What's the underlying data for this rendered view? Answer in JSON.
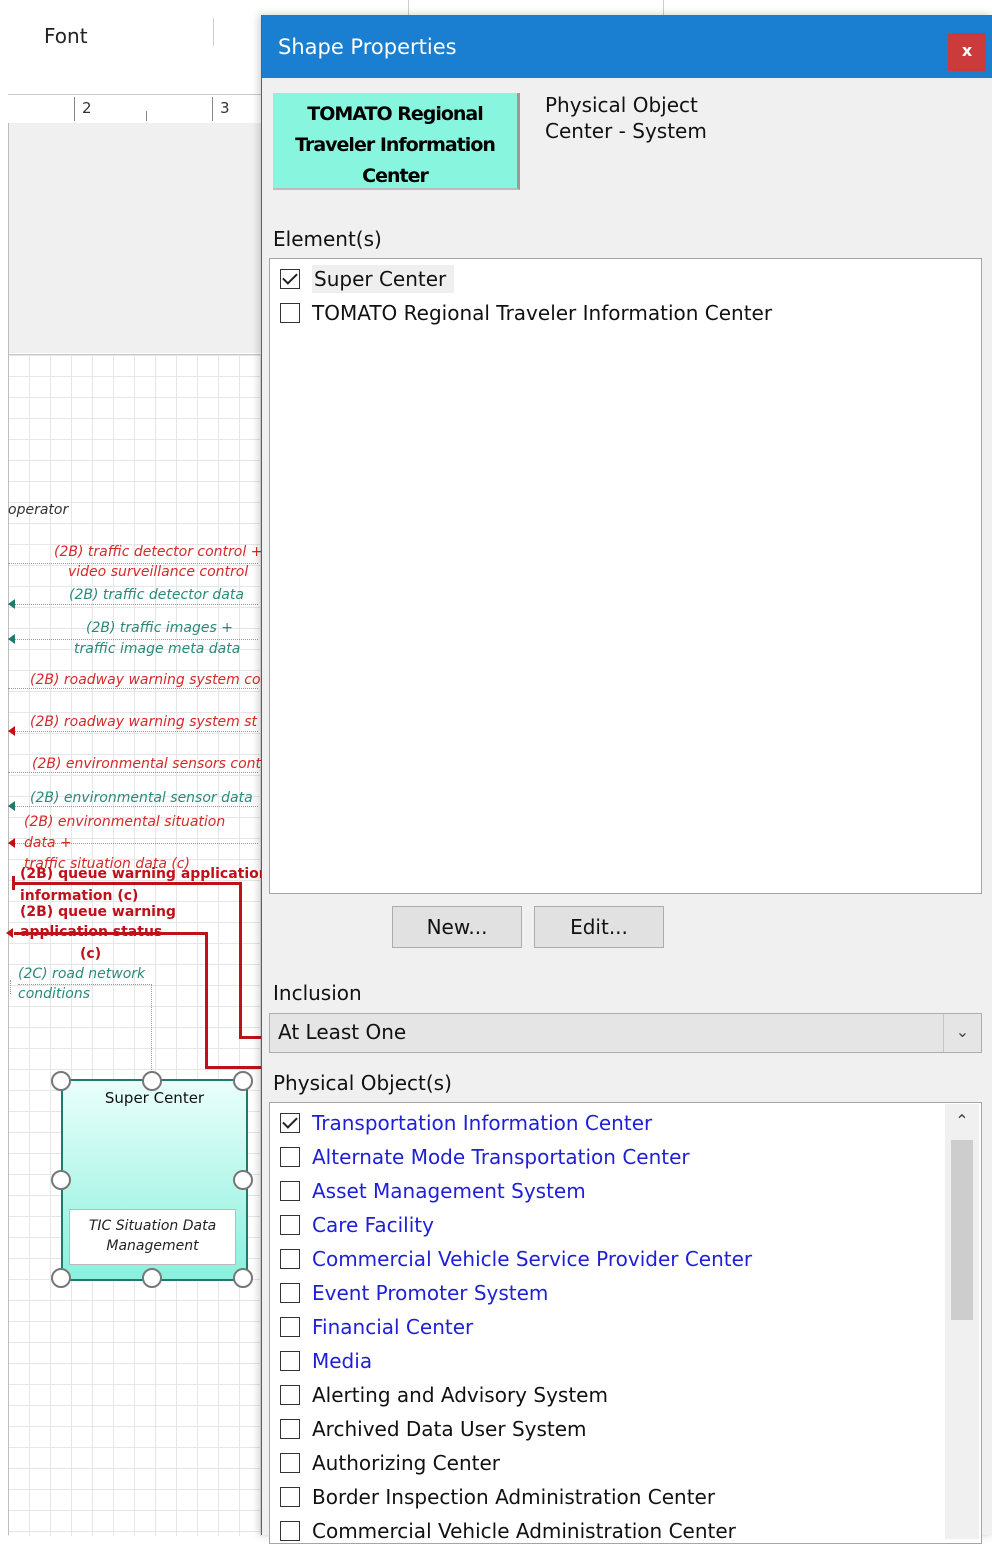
{
  "ribbon": {
    "font_group": "Font"
  },
  "ruler": {
    "marks": [
      "2",
      "3"
    ]
  },
  "diagram": {
    "flows": [
      {
        "text": "operator",
        "style": "dark"
      },
      {
        "text": "(2B) traffic detector control +",
        "style": "red"
      },
      {
        "text": "video surveillance control",
        "style": "red"
      },
      {
        "text": "(2B) traffic detector data",
        "style": "teal"
      },
      {
        "text": "(2B) traffic images +",
        "style": "teal"
      },
      {
        "text": "traffic image meta data",
        "style": "teal"
      },
      {
        "text": "(2B) roadway warning system co",
        "style": "red"
      },
      {
        "text": "(2B) roadway warning system st",
        "style": "red"
      },
      {
        "text": "(2B) environmental sensors cont",
        "style": "red"
      },
      {
        "text": "(2B) environmental sensor data",
        "style": "teal"
      },
      {
        "text": "(2B) environmental situation",
        "style": "red"
      },
      {
        "text": "data +",
        "style": "red"
      },
      {
        "text": "traffic situation data (c)",
        "style": "red"
      },
      {
        "text": "(2B) queue warning application",
        "style": "bold"
      },
      {
        "text": "information (c)",
        "style": "bold"
      },
      {
        "text": "(2B) queue warning",
        "style": "bold"
      },
      {
        "text": "application status",
        "style": "bold"
      },
      {
        "text": "(c)",
        "style": "bold"
      },
      {
        "text": "(2C) road network",
        "style": "teal"
      },
      {
        "text": "conditions",
        "style": "teal"
      }
    ],
    "shape": {
      "title": "Super Center",
      "inner": "TIC Situation Data Management"
    }
  },
  "dialog": {
    "title": "Shape Properties",
    "close_label": "x",
    "preview_text": "TOMATO Regional Traveler Information Center",
    "kind_line1": "Physical Object",
    "kind_line2": "Center - System",
    "elements_label": "Element(s)",
    "elements": [
      {
        "label": "Super Center",
        "checked": true
      },
      {
        "label": "TOMATO Regional Traveler Information Center",
        "checked": false
      }
    ],
    "new_button": "New...",
    "edit_button": "Edit...",
    "inclusion_label": "Inclusion",
    "inclusion_value": "At Least One",
    "physical_objects_label": "Physical Object(s)",
    "physical_objects": [
      {
        "label": "Transportation Information Center",
        "checked": true,
        "color": "blue"
      },
      {
        "label": "Alternate Mode Transportation Center",
        "checked": false,
        "color": "blue"
      },
      {
        "label": "Asset Management System",
        "checked": false,
        "color": "blue"
      },
      {
        "label": "Care Facility",
        "checked": false,
        "color": "blue"
      },
      {
        "label": "Commercial Vehicle Service Provider Center",
        "checked": false,
        "color": "blue"
      },
      {
        "label": "Event Promoter System",
        "checked": false,
        "color": "blue"
      },
      {
        "label": "Financial Center",
        "checked": false,
        "color": "blue"
      },
      {
        "label": "Media",
        "checked": false,
        "color": "blue"
      },
      {
        "label": "Alerting and Advisory System",
        "checked": false,
        "color": "black"
      },
      {
        "label": "Archived Data User System",
        "checked": false,
        "color": "black"
      },
      {
        "label": "Authorizing Center",
        "checked": false,
        "color": "black"
      },
      {
        "label": "Border Inspection Administration Center",
        "checked": false,
        "color": "black"
      },
      {
        "label": "Commercial Vehicle Administration Center",
        "checked": false,
        "color": "black"
      }
    ]
  },
  "colors": {
    "title_bar": "#1b7fd1",
    "close_button": "#cc3b3b",
    "preview_fill": "#88f5df",
    "link_blue": "#1f1fd6",
    "flow_red": "#d42a2a",
    "flow_teal": "#2a8a7a"
  }
}
